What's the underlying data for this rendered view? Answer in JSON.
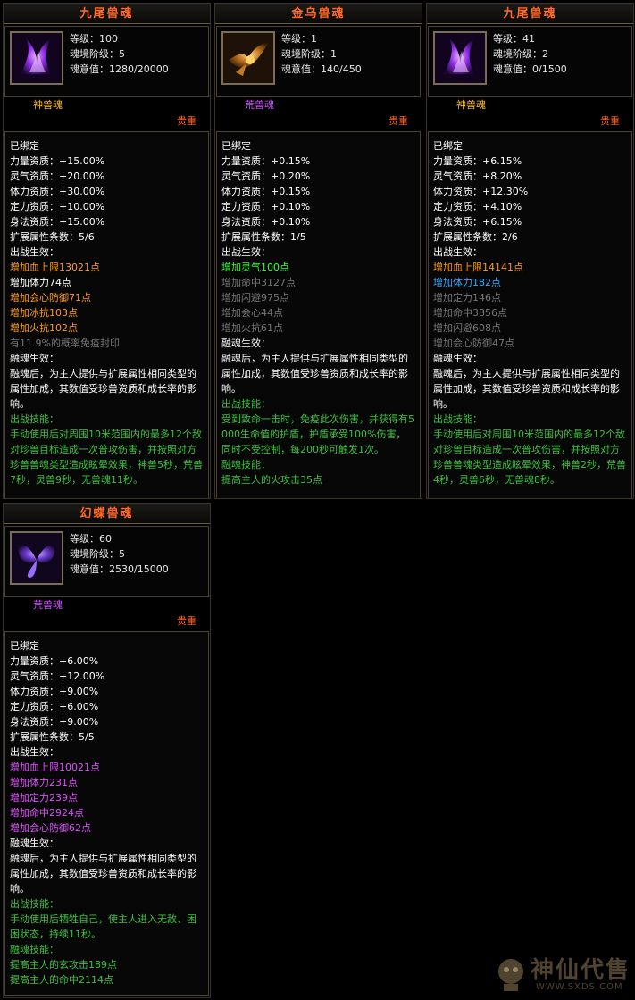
{
  "cards": [
    {
      "title": "九尾兽魂",
      "level": "等级：100",
      "stage": "魂境阶级：5",
      "soul": "魂意值：1280/20000",
      "soul_type": "神兽魂",
      "soul_type_color": "#ffbf2a",
      "rarity": "贵重",
      "icon": "nine-tail-fox-icon",
      "lines": [
        {
          "t": "已绑定",
          "c": "w"
        },
        {
          "t": "力量资质：+15.00%",
          "c": "w"
        },
        {
          "t": "灵气资质：+20.00%",
          "c": "w"
        },
        {
          "t": "体力资质：+30.00%",
          "c": "w"
        },
        {
          "t": "定力资质：+10.00%",
          "c": "w"
        },
        {
          "t": "身法资质：+15.00%",
          "c": "w"
        },
        {
          "t": "扩展属性条数：5/6",
          "c": "w"
        },
        {
          "t": "出战生效：",
          "c": "w"
        },
        {
          "t": "增加血上限13021点",
          "c": "o"
        },
        {
          "t": "增加体力74点",
          "c": "w"
        },
        {
          "t": "增加会心防御71点",
          "c": "o"
        },
        {
          "t": "增加冰抗103点",
          "c": "o"
        },
        {
          "t": "增加火抗102点",
          "c": "o"
        },
        {
          "t": "有11.9%的概率免疫封印",
          "c": "g"
        },
        {
          "t": "融魂生效：",
          "c": "w"
        },
        {
          "t": "融魂后，为主人提供与扩展属性相同类型的属性加成，其数值受珍兽资质和成长率的影响。",
          "c": "w",
          "wrap": true
        },
        {
          "t": "出战技能：",
          "c": "gg"
        },
        {
          "t": "手动使用后对周围10米范围内的最多12个敌对珍兽目标造成一次普攻伤害，并按照对方珍兽兽魂类型造成眩晕效果，神兽5秒，荒兽7秒，灵兽9秒，无兽魂11秒。",
          "c": "gg",
          "wrap": true
        }
      ]
    },
    {
      "title": "金乌兽魂",
      "level": "等级：1",
      "stage": "魂境阶级：1",
      "soul": "魂意值：140/450",
      "soul_type": "荒兽魂",
      "soul_type_color": "#d050ff",
      "rarity": "贵重",
      "icon": "golden-crow-icon",
      "lines": [
        {
          "t": "已绑定",
          "c": "w"
        },
        {
          "t": "力量资质：+0.15%",
          "c": "w"
        },
        {
          "t": "灵气资质：+0.20%",
          "c": "w"
        },
        {
          "t": "体力资质：+0.15%",
          "c": "w"
        },
        {
          "t": "定力资质：+0.10%",
          "c": "w"
        },
        {
          "t": "身法资质：+0.10%",
          "c": "w"
        },
        {
          "t": "扩展属性条数：1/5",
          "c": "w"
        },
        {
          "t": "出战生效：",
          "c": "w"
        },
        {
          "t": "增加灵气100点",
          "c": "bg"
        },
        {
          "t": "增加命中3127点",
          "c": "g"
        },
        {
          "t": "增加闪避975点",
          "c": "g"
        },
        {
          "t": "增加会心44点",
          "c": "g"
        },
        {
          "t": "增加火抗61点",
          "c": "g"
        },
        {
          "t": "融魂生效：",
          "c": "w"
        },
        {
          "t": "融魂后，为主人提供与扩展属性相同类型的属性加成，其数值受珍兽资质和成长率的影响。",
          "c": "w",
          "wrap": true
        },
        {
          "t": "出战技能：",
          "c": "gg"
        },
        {
          "t": "受到致命一击时，免疫此次伤害，并获得有5000生命值的护盾，护盾承受100%伤害，同时不受控制，每200秒可触发1次。",
          "c": "gg",
          "wrap": true
        },
        {
          "t": "融魂技能：",
          "c": "gg"
        },
        {
          "t": "提高主人的火攻击35点",
          "c": "gg"
        }
      ]
    },
    {
      "title": "九尾兽魂",
      "level": "等级：41",
      "stage": "魂境阶级：2",
      "soul": "魂意值：0/1500",
      "soul_type": "神兽魂",
      "soul_type_color": "#ffbf2a",
      "rarity": "贵重",
      "icon": "nine-tail-fox-icon",
      "lines": [
        {
          "t": "已绑定",
          "c": "w"
        },
        {
          "t": "力量资质：+6.15%",
          "c": "w"
        },
        {
          "t": "灵气资质：+8.20%",
          "c": "w"
        },
        {
          "t": "体力资质：+12.30%",
          "c": "w"
        },
        {
          "t": "定力资质：+4.10%",
          "c": "w"
        },
        {
          "t": "身法资质：+6.15%",
          "c": "w"
        },
        {
          "t": "扩展属性条数：2/6",
          "c": "w"
        },
        {
          "t": "出战生效：",
          "c": "w"
        },
        {
          "t": "增加血上限14141点",
          "c": "o"
        },
        {
          "t": "增加体力182点",
          "c": "b"
        },
        {
          "t": "增加定力146点",
          "c": "g"
        },
        {
          "t": "增加命中3856点",
          "c": "g"
        },
        {
          "t": "增加闪避608点",
          "c": "g"
        },
        {
          "t": "增加会心防御47点",
          "c": "g"
        },
        {
          "t": "融魂生效：",
          "c": "w"
        },
        {
          "t": "融魂后，为主人提供与扩展属性相同类型的属性加成，其数值受珍兽资质和成长率的影响。",
          "c": "w",
          "wrap": true
        },
        {
          "t": "出战技能：",
          "c": "gg"
        },
        {
          "t": "手动使用后对周围10米范围内的最多12个敌对珍兽目标造成一次普攻伤害，并按照对方珍兽兽魂类型造成眩晕效果，神兽2秒，荒兽4秒，灵兽6秒，无兽魂8秒。",
          "c": "gg",
          "wrap": true
        }
      ]
    },
    {
      "title": "幻蝶兽魂",
      "level": "等级：60",
      "stage": "魂境阶级：5",
      "soul": "魂意值：2530/15000",
      "soul_type": "荒兽魂",
      "soul_type_color": "#d050ff",
      "rarity": "贵重",
      "icon": "phantom-butterfly-icon",
      "lines": [
        {
          "t": "已绑定",
          "c": "w"
        },
        {
          "t": "力量资质：+6.00%",
          "c": "w"
        },
        {
          "t": "灵气资质：+12.00%",
          "c": "w"
        },
        {
          "t": "体力资质：+9.00%",
          "c": "w"
        },
        {
          "t": "定力资质：+6.00%",
          "c": "w"
        },
        {
          "t": "身法资质：+9.00%",
          "c": "w"
        },
        {
          "t": "扩展属性条数：5/5",
          "c": "w"
        },
        {
          "t": "出战生效：",
          "c": "w"
        },
        {
          "t": "增加血上限10021点",
          "c": "p"
        },
        {
          "t": "增加体力231点",
          "c": "p"
        },
        {
          "t": "增加定力239点",
          "c": "p"
        },
        {
          "t": "增加命中2924点",
          "c": "p"
        },
        {
          "t": "增加会心防御62点",
          "c": "p"
        },
        {
          "t": "融魂生效：",
          "c": "w"
        },
        {
          "t": "融魂后，为主人提供与扩展属性相同类型的属性加成，其数值受珍兽资质和成长率的影响。",
          "c": "w",
          "wrap": true
        },
        {
          "t": "出战技能：",
          "c": "gg"
        },
        {
          "t": "手动使用后牺牲自己，使主人进入无敌、困困状态，持续11秒。",
          "c": "gg",
          "wrap": true
        },
        {
          "t": "融魂技能：",
          "c": "gg"
        },
        {
          "t": "提高主人的玄攻击189点",
          "c": "gg"
        },
        {
          "t": "提高主人的命中2114点",
          "c": "gg"
        }
      ]
    }
  ],
  "watermark": {
    "text": "神仙代售",
    "url": "WWW.SXDS.COM"
  }
}
